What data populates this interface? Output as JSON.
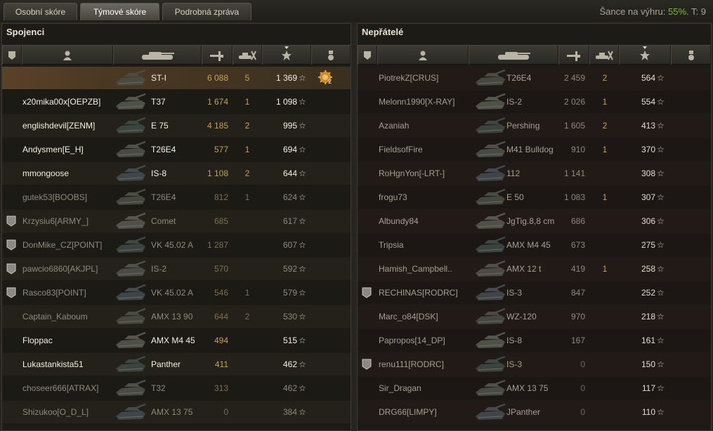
{
  "tabs": [
    {
      "label": "Osobní skóre",
      "active": false
    },
    {
      "label": "Týmové skóre",
      "active": true
    },
    {
      "label": "Podrobná zpráva",
      "active": false
    }
  ],
  "win_chance": {
    "prefix": "Šance na výhru: ",
    "value": "55%",
    "suffix": ". T: 9"
  },
  "allies": {
    "title": "Spojenci",
    "rows": [
      {
        "name": "",
        "tank": "ST-I",
        "damage": "6 088",
        "kills": "5",
        "xp": "1 369",
        "player": true,
        "medal": true,
        "medal_count": "2",
        "style": "bright"
      },
      {
        "name": "x20mika00x[OEPZB]",
        "tank": "T37",
        "damage": "1 674",
        "kills": "1",
        "xp": "1 098",
        "style": "bright"
      },
      {
        "name": "englishdevil[ZENM]",
        "tank": "E 75",
        "damage": "4 185",
        "kills": "2",
        "xp": "995",
        "style": "bright"
      },
      {
        "name": "Andysmen[E_H]",
        "tank": "T26E4",
        "damage": "577",
        "kills": "1",
        "xp": "694",
        "style": "bright"
      },
      {
        "name": "mmongoose",
        "tank": "IS-8",
        "damage": "1 108",
        "kills": "2",
        "xp": "644",
        "style": "bright"
      },
      {
        "name": "gutek53[BOOBS]",
        "tank": "T26E4",
        "damage": "812",
        "kills": "1",
        "xp": "624",
        "style": "dim"
      },
      {
        "name": "Krzysiu6[ARMY_]",
        "tank": "Comet",
        "damage": "685",
        "kills": "",
        "xp": "617",
        "badge": "2",
        "style": "dim"
      },
      {
        "name": "DonMike_CZ[POINT]",
        "tank": "VK 45.02 A",
        "damage": "1 287",
        "kills": "",
        "xp": "607",
        "badge": "1",
        "style": "dim"
      },
      {
        "name": "pawcio6860[AKJPL]",
        "tank": "IS-2",
        "damage": "570",
        "kills": "",
        "xp": "592",
        "badge": "2",
        "style": "dim"
      },
      {
        "name": "Rasco83[POINT]",
        "tank": "VK 45.02 A",
        "damage": "546",
        "kills": "1",
        "xp": "579",
        "badge": "1",
        "style": "dim"
      },
      {
        "name": "Captain_Kaboum",
        "tank": "AMX 13 90",
        "damage": "644",
        "kills": "2",
        "xp": "530",
        "style": "dim"
      },
      {
        "name": "Floppac",
        "tank": "AMX M4 45",
        "damage": "494",
        "kills": "",
        "xp": "515",
        "style": "bright"
      },
      {
        "name": "Lukastankista51",
        "tank": "Panther",
        "damage": "411",
        "kills": "",
        "xp": "462",
        "style": "bright"
      },
      {
        "name": "choseer666[ATRAX]",
        "tank": "T32",
        "damage": "313",
        "kills": "",
        "xp": "462",
        "style": "dim"
      },
      {
        "name": "Shizukoo[O_D_L]",
        "tank": "AMX 13 75",
        "damage": "0",
        "kills": "",
        "xp": "384",
        "style": "dim"
      }
    ]
  },
  "enemies": {
    "title": "Nepřátelé",
    "rows": [
      {
        "name": "PiotrekZ[CRUS]",
        "tank": "T26E4",
        "damage": "2 459",
        "kills": "2",
        "xp": "564"
      },
      {
        "name": "Melonn1990[X-RAY]",
        "tank": "IS-2",
        "damage": "2 026",
        "kills": "1",
        "xp": "554"
      },
      {
        "name": "Azaniah",
        "tank": "Pershing",
        "damage": "1 605",
        "kills": "2",
        "xp": "413"
      },
      {
        "name": "FieldsofFire",
        "tank": "M41 Bulldog",
        "damage": "910",
        "kills": "1",
        "xp": "370"
      },
      {
        "name": "RoHgnYon[-LRT-]",
        "tank": "112",
        "damage": "1 141",
        "kills": "",
        "xp": "308"
      },
      {
        "name": "frogu73",
        "tank": "E 50",
        "damage": "1 083",
        "kills": "1",
        "xp": "307"
      },
      {
        "name": "Albundy84",
        "tank": "JgTig.8,8 cm",
        "damage": "686",
        "kills": "",
        "xp": "306"
      },
      {
        "name": "Tripsia",
        "tank": "AMX M4 45",
        "damage": "673",
        "kills": "",
        "xp": "275"
      },
      {
        "name": "Hamish_Campbell..",
        "tank": "AMX 12 t",
        "damage": "419",
        "kills": "1",
        "xp": "258"
      },
      {
        "name": "RECHINAS[RODRC]",
        "tank": "IS-3",
        "damage": "847",
        "kills": "",
        "xp": "252",
        "badge": "1"
      },
      {
        "name": "Marc_o84[DSK]",
        "tank": "WZ-120",
        "damage": "970",
        "kills": "",
        "xp": "218"
      },
      {
        "name": "Papropos[14_DP]",
        "tank": "IS-8",
        "damage": "167",
        "kills": "",
        "xp": "161"
      },
      {
        "name": "renu111[RODRC]",
        "tank": "IS-3",
        "damage": "0",
        "kills": "",
        "xp": "150",
        "badge": "1"
      },
      {
        "name": "Sir_Dragan",
        "tank": "AMX 13 75",
        "damage": "0",
        "kills": "",
        "xp": "117"
      },
      {
        "name": "DRG66[LIMPY]",
        "tank": "JPanther",
        "damage": "0",
        "kills": "",
        "xp": "110"
      }
    ]
  },
  "star_glyph": "☆",
  "colors": {
    "accent_green": "#7dbb2e",
    "damage_gold": "#c4a05a",
    "player_row": "#5a4228"
  }
}
